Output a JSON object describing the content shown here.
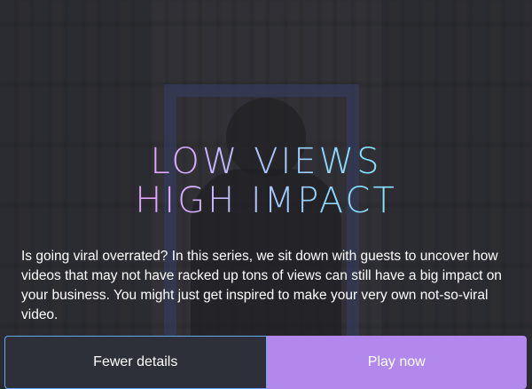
{
  "hero": {
    "logo_line1": "LOW VIEWS",
    "logo_line2": "HIGH IMPACT",
    "description": "Is going viral overrated? In this series, we sit down with guests to uncover how videos that may not have racked up tons of views can still have a big impact on your business. You might just get inspired to make your very own not-so-viral video."
  },
  "actions": {
    "secondary_label": "Fewer details",
    "primary_label": "Play now"
  },
  "colors": {
    "primary": "#b388ec",
    "secondary_bg": "#2d3038",
    "focus_outline": "#6aa6ff",
    "background": "#303136"
  }
}
